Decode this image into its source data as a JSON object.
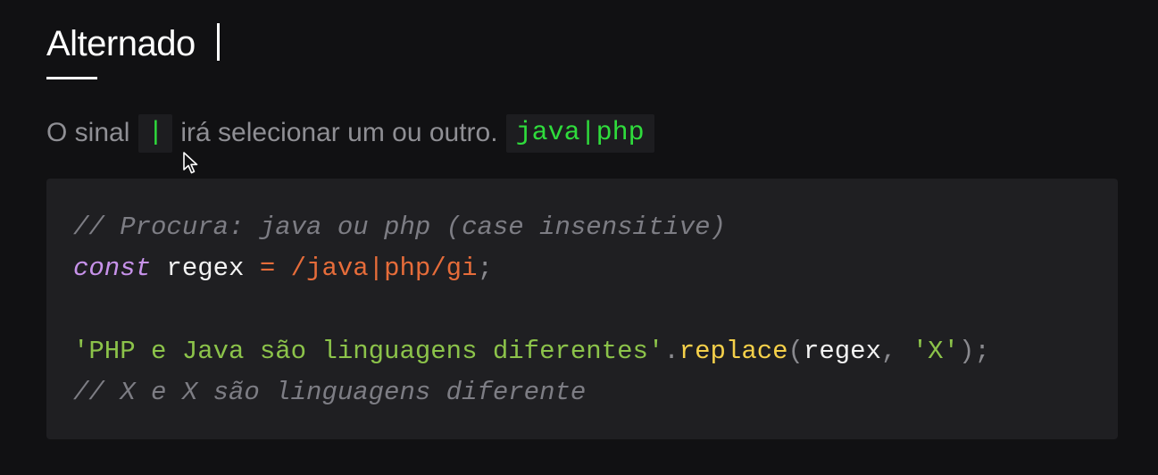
{
  "heading": {
    "title": "Alternado"
  },
  "paragraph": {
    "intro": "O sinal",
    "pipe_code": "|",
    "middle": "irá selecionar um ou outro.",
    "example_code": "java|php"
  },
  "code_block": {
    "line1_comment": "// Procura: java ou php (case insensitive)",
    "line2": {
      "keyword": "const",
      "identifier": "regex",
      "operator": "=",
      "regex": "/java|php/gi",
      "terminator": ";"
    },
    "line3": {
      "string": "'PHP e Java são linguagens diferentes'",
      "dot": ".",
      "method": "replace",
      "open_paren": "(",
      "argument": "regex",
      "comma": ",",
      "replacement": "'X'",
      "close": ");"
    },
    "line4_comment": "// X e X são linguagens diferente"
  },
  "colors": {
    "background": "#111113",
    "inline_code_text": "#2fdc3c",
    "comment": "#7d7d84",
    "keyword": "#c792ea",
    "regex": "#e66c3a",
    "string": "#8cc34a",
    "function": "#f5d04a"
  },
  "icons": {
    "mouse_pointer": "mouse-pointer-icon"
  }
}
